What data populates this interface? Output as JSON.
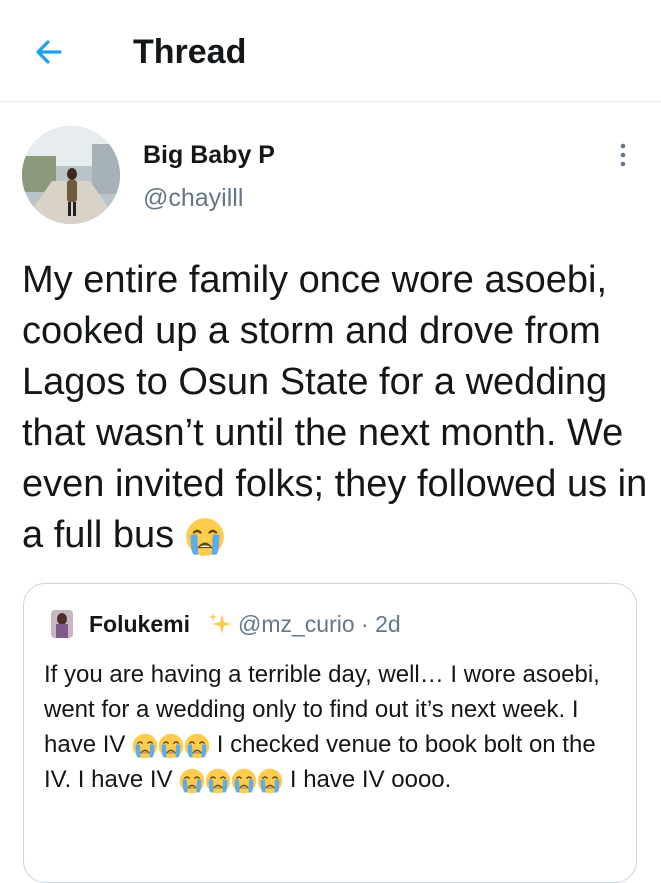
{
  "header": {
    "title": "Thread"
  },
  "tweet": {
    "author_name": "Big Baby P",
    "author_handle": "@chayilll",
    "text": "My entire family once wore asoebi, cooked up a storm and drove from Lagos to Osun State for a wedding that wasn’t until the next month. We even invited folks; they followed us in a full bus",
    "trailing_emoji": "loudly-crying-face"
  },
  "quoted_tweet": {
    "author_name": "Folukemi",
    "author_handle": "@mz_curio",
    "separator": "·",
    "age": "2d",
    "segment_1": "If you are having a terrible day, well… I wore asoebi, went for a wedding only to find out it’s next week. I have IV",
    "segment_2": "I checked venue to book bolt on the IV. I have IV",
    "segment_3": "I have IV oooo.",
    "emoji_run_1_count": 3,
    "emoji_run_2_count": 4
  },
  "colors": {
    "accent": "#1da1f2",
    "text": "#14171a",
    "secondary": "#657786",
    "border": "#ccd6dd"
  },
  "icons": {
    "back": "arrow-left-icon",
    "more": "more-vertical-icon",
    "emoji": "loudly-crying-face",
    "sparkle": "sparkles-icon"
  }
}
